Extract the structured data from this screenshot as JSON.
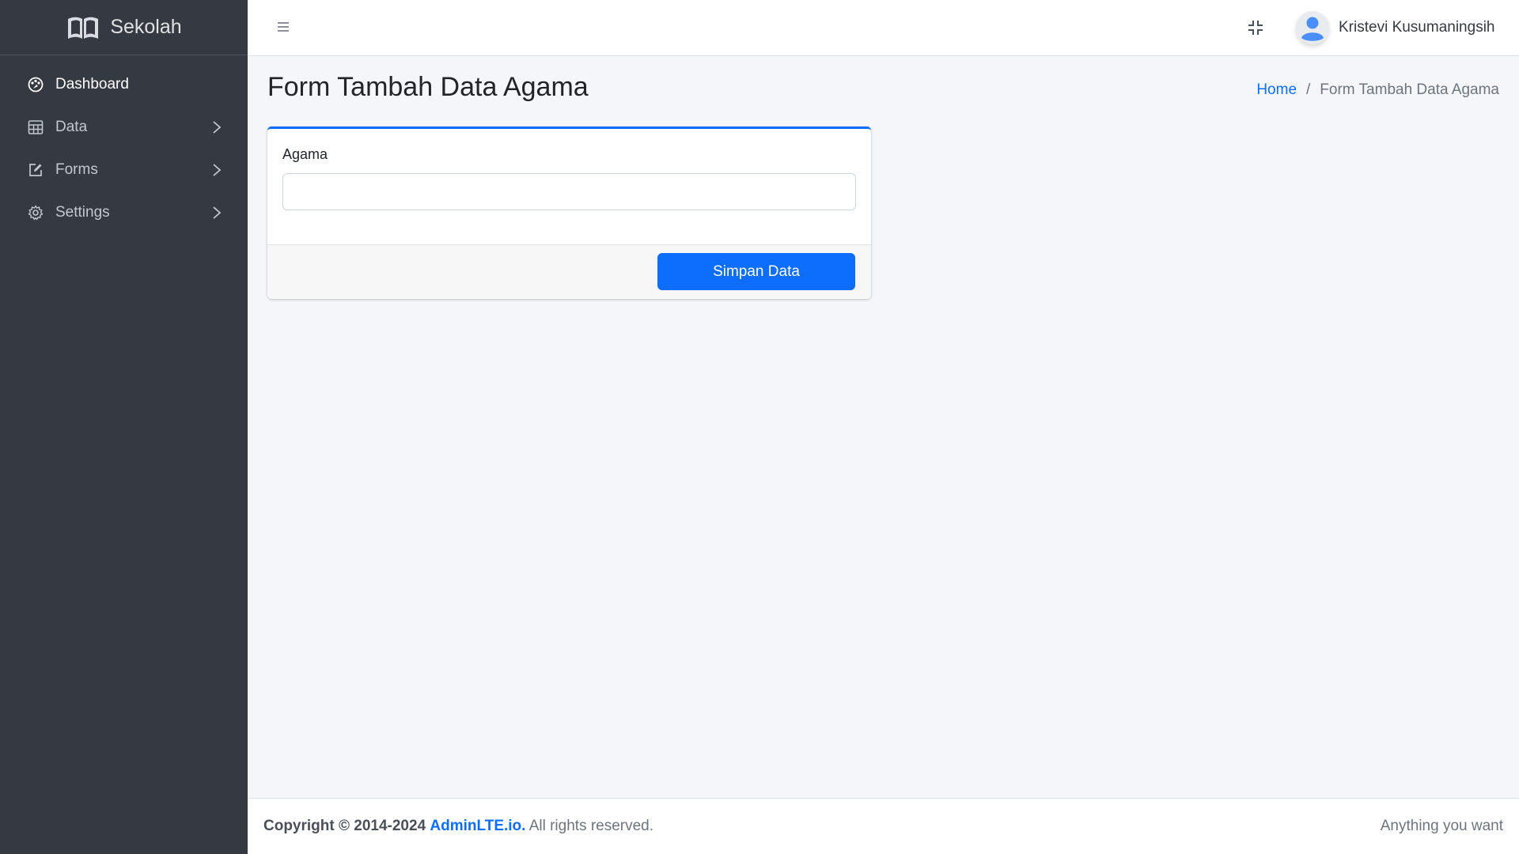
{
  "brand": {
    "name": "Sekolah",
    "logo_icon": "book-open-icon"
  },
  "sidebar": {
    "items": [
      {
        "label": "Dashboard",
        "icon": "palette-icon",
        "active": true,
        "has_submenu": false
      },
      {
        "label": "Data",
        "icon": "table-icon",
        "active": false,
        "has_submenu": true
      },
      {
        "label": "Forms",
        "icon": "pencil-square-icon",
        "active": false,
        "has_submenu": true
      },
      {
        "label": "Settings",
        "icon": "gear-icon",
        "active": false,
        "has_submenu": true
      }
    ]
  },
  "topbar": {
    "menu_icon": "hamburger-icon",
    "fullscreen_icon": "fullscreen-exit-icon",
    "user_name": "Kristevi Kusumaningsih",
    "avatar_icon": "user-avatar-icon"
  },
  "page": {
    "title": "Form Tambah Data Agama",
    "breadcrumb": {
      "home": "Home",
      "separator": "/",
      "current": "Form Tambah Data Agama"
    }
  },
  "form": {
    "field_label": "Agama",
    "field_value": "",
    "submit_label": "Simpan Data"
  },
  "footer": {
    "copyright": "Copyright © 2014-2024",
    "link": "AdminLTE.io.",
    "rights": "All rights reserved.",
    "right_text": "Anything you want"
  },
  "colors": {
    "sidebar_bg": "#343a40",
    "primary": "#0d6efd",
    "content_bg": "#f4f6f9"
  }
}
